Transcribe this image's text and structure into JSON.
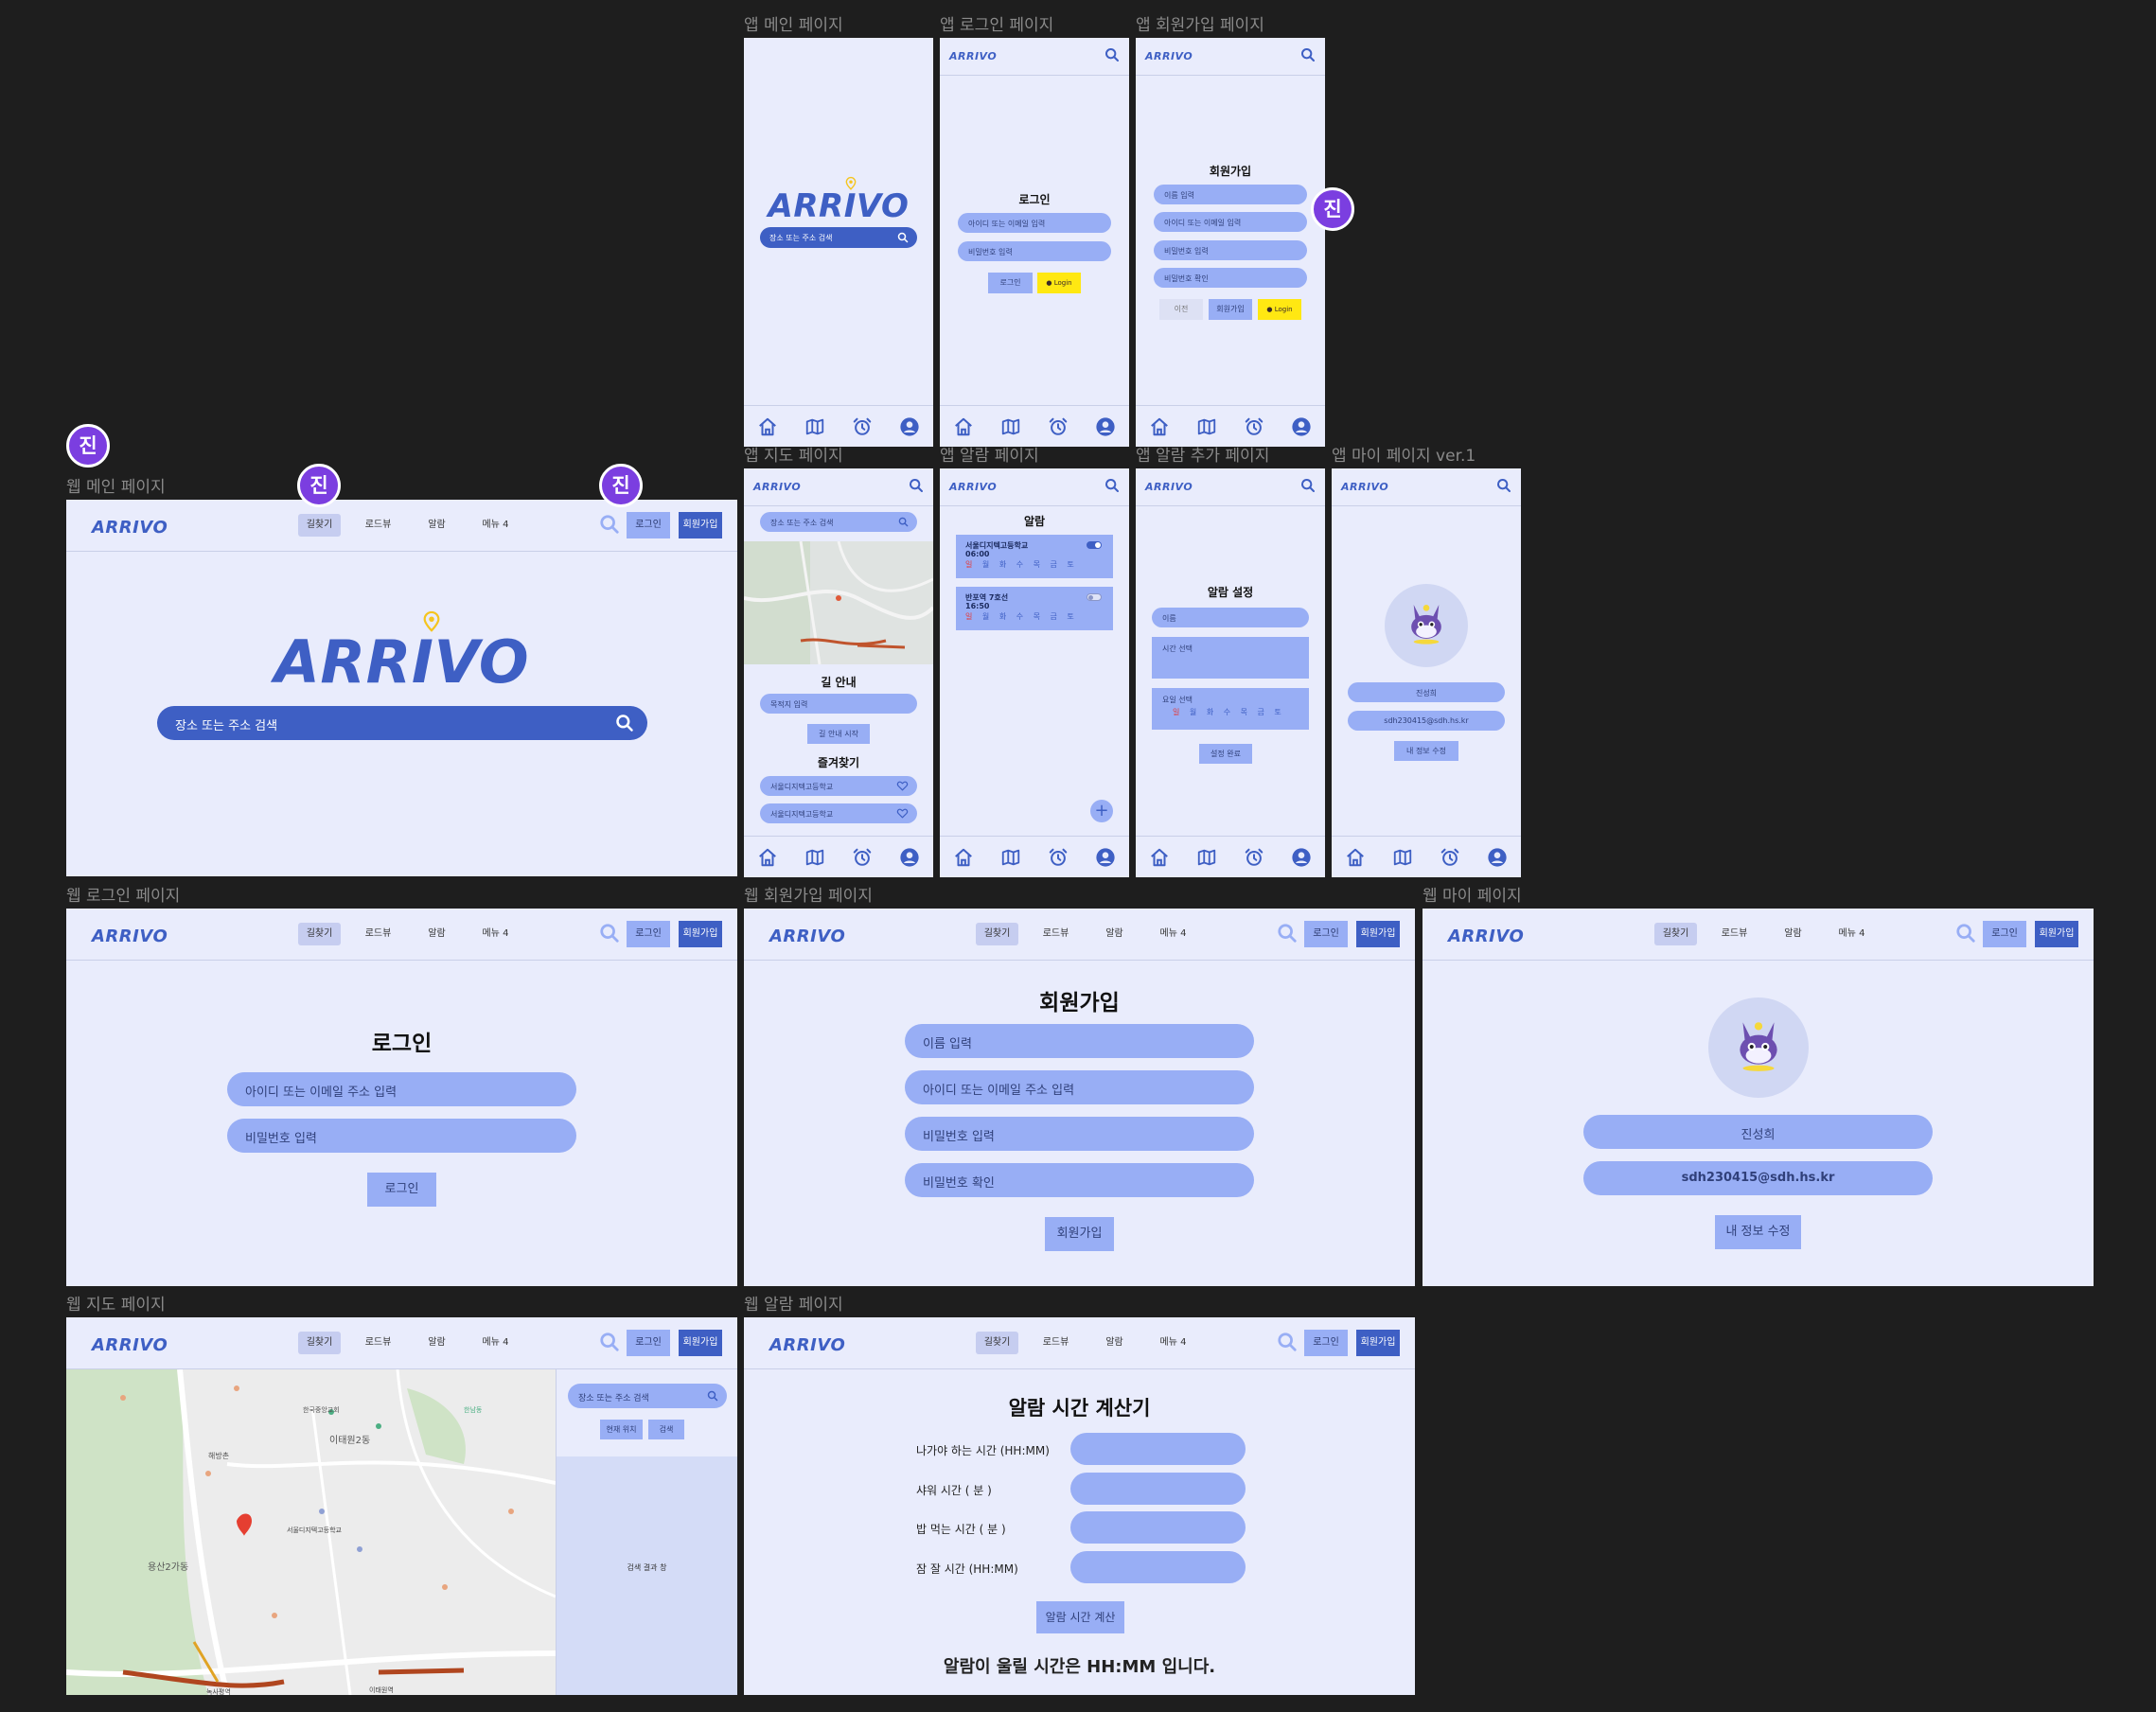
{
  "brand": {
    "logo": "ARRIVO"
  },
  "frames": {
    "app_main": "앱 메인 페이지",
    "app_login": "앱 로그인 페이지",
    "app_signup": "앱 회원가입 페이지",
    "app_map": "앱 지도 페이지",
    "app_alarm": "앱 알람 페이지",
    "app_alarm_add": "앱 알람 추가 페이지",
    "app_mypage": "앱 마이 페이지 ver.1",
    "web_main": "웹 메인 페이지",
    "web_login": "웹 로그인 페이지",
    "web_signup": "웹 회원가입 페이지",
    "web_mypage": "웹 마이 페이지",
    "web_map": "웹 지도 페이지",
    "web_alarm": "웹 알람 페이지"
  },
  "collaborator": {
    "initial": "진"
  },
  "nav": {
    "items": [
      "길찾기",
      "로드뷰",
      "알람",
      "메뉴 4"
    ],
    "login": "로그인",
    "signup": "회원가입"
  },
  "search": {
    "placeholder": "장소 또는 주소 검색"
  },
  "login": {
    "title": "로그인",
    "id_placeholder": "아이디 또는 이메일 주소 입력",
    "id_placeholder_short": "아이디 또는 이메일 입력",
    "pw_placeholder": "비밀번호 입력",
    "button": "로그인",
    "kakao": "Login"
  },
  "signup": {
    "title": "회원가입",
    "name": "이름 입력",
    "id": "아이디 또는 이메일 주소 입력",
    "id_short": "아이디 또는 이메일 입력",
    "pw": "비밀번호 입력",
    "pw_confirm": "비밀번호 확인",
    "prev": "이전",
    "button": "회원가입"
  },
  "app_map": {
    "guide_title": "길 안내",
    "destination": "목적지 입력",
    "start": "길 안내 시작",
    "favorites_title": "즐겨찾기",
    "favorites": [
      "서울디지텍고등학교",
      "서울디지텍고등학교"
    ]
  },
  "alarm": {
    "title": "알람",
    "items": [
      {
        "name": "서울디지텍고등학교",
        "time": "06:00",
        "on": true
      },
      {
        "name": "반포역 7호선",
        "time": "16:50",
        "on": false
      }
    ],
    "days_sun": "일",
    "days_rest": "월 화 수 목 금 토"
  },
  "alarm_add": {
    "title": "알람 설정",
    "name": "이름",
    "time": "시간 선택",
    "day": "요일 선택",
    "done": "설정 완료"
  },
  "profile": {
    "name": "진성희",
    "email": "sdh230415@sdh.hs.kr",
    "edit": "내 정보 수정"
  },
  "web_map": {
    "current": "현재 위치",
    "search": "검색",
    "results": "검색 결과 창",
    "labels": [
      "이태원2동",
      "용산2가동",
      "서울디지텍고등학교",
      "해방촌",
      "녹사평역",
      "이태원역",
      "한남동",
      "한국중앙교회"
    ]
  },
  "alarm_calc": {
    "title": "알람 시간 계산기",
    "fields": [
      "나가야 하는 시간 (HH:MM)",
      "샤워 시간 ( 분 )",
      "밥 먹는 시간 ( 분 )",
      "잠 잘 시간 (HH:MM)"
    ],
    "button": "알람 시간 계산",
    "result": "알람이 울릴 시간은  HH:MM 입니다."
  },
  "colors": {
    "background": "#1e1e1e",
    "frame": "#e9ecfc",
    "accent": "#3e5fc4",
    "pill": "#98aef5",
    "avatar": "#7b3ee0",
    "kakao": "#ffe812",
    "pin": "#f5c51f"
  }
}
